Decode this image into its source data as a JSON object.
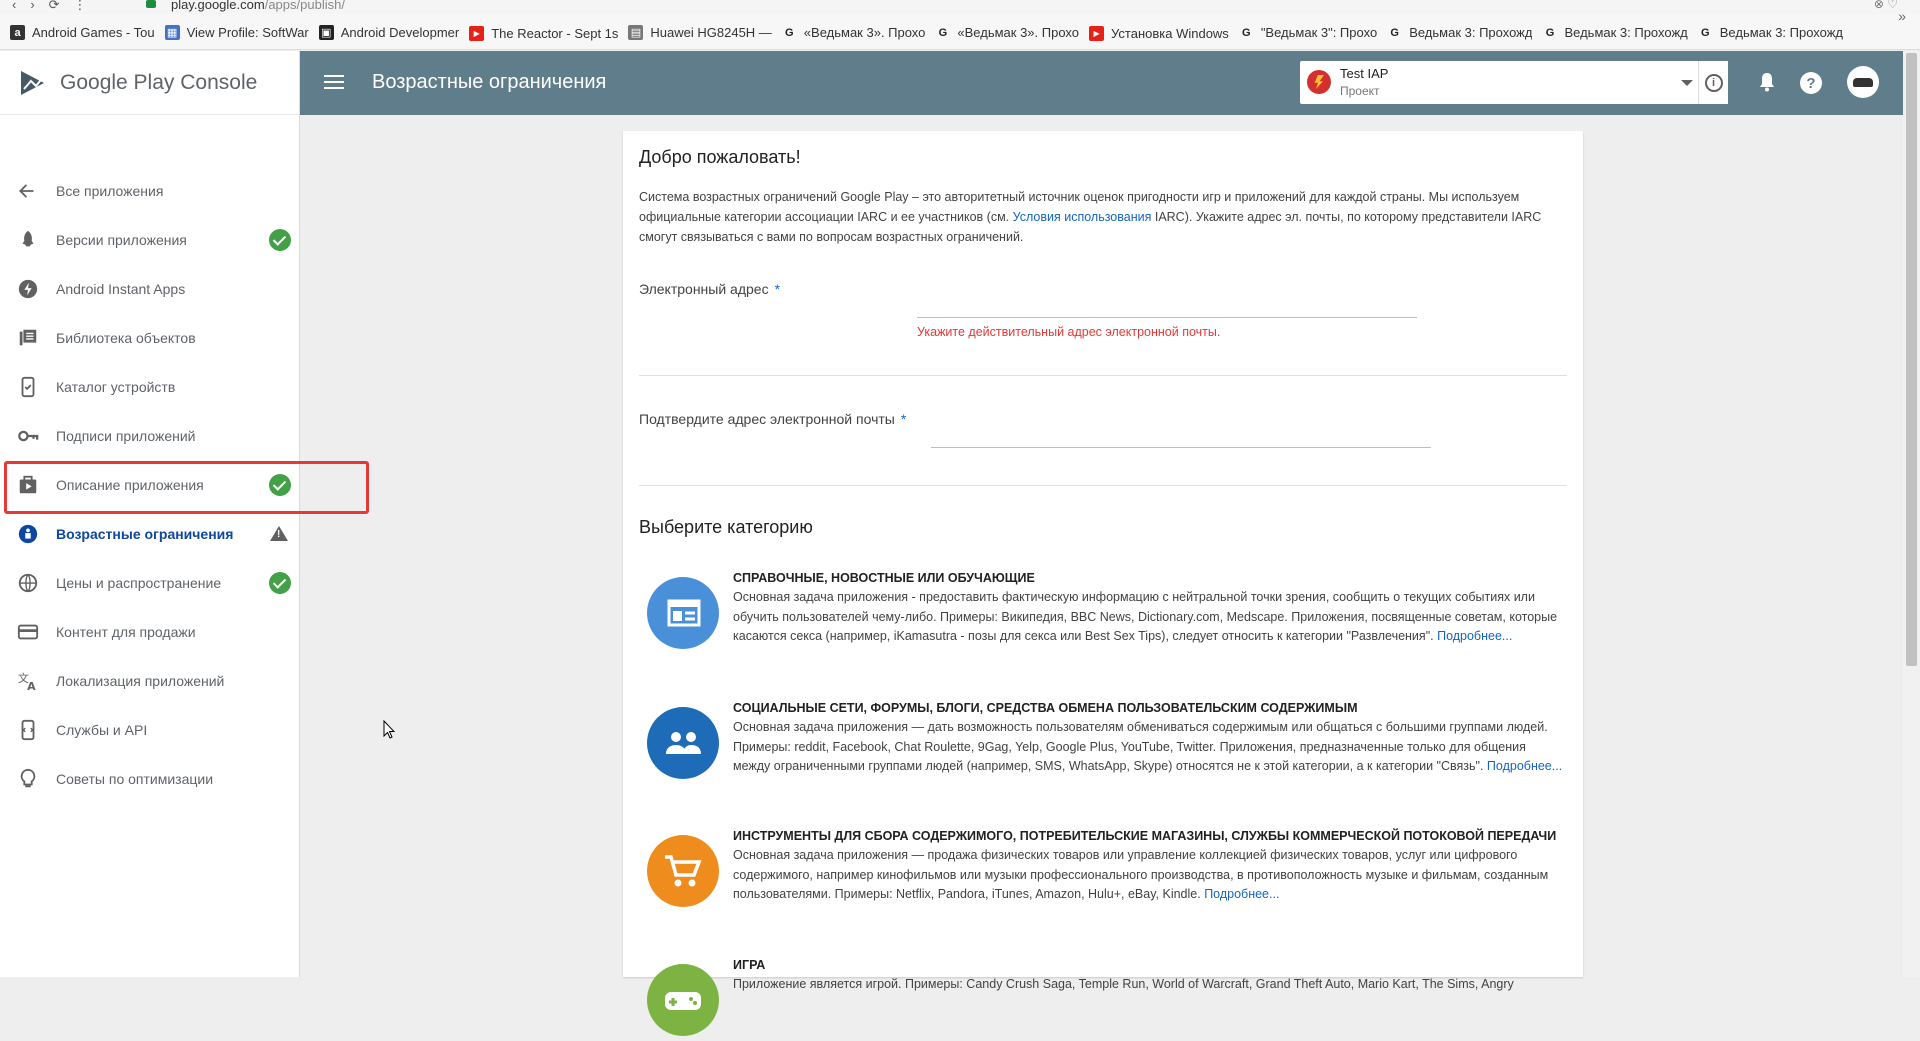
{
  "browser": {
    "url_host": "play.google.com",
    "url_path": "/apps/publish/",
    "bookmarks": [
      {
        "label": "Android Games - Tou",
        "icon": "android-games-icon",
        "color": "#333333",
        "glyph": "a"
      },
      {
        "label": "View Profile: SoftWar",
        "icon": "profile-icon",
        "color": "#4472c4",
        "glyph": "▦"
      },
      {
        "label": "Android Developmer",
        "icon": "dev-icon",
        "color": "#222222",
        "glyph": "▣"
      },
      {
        "label": "The Reactor - Sept 1s",
        "icon": "youtube-icon",
        "color": "#e62117",
        "glyph": "▶"
      },
      {
        "label": "Huawei HG8245H —",
        "icon": "document-icon",
        "color": "#777777",
        "glyph": "▤"
      },
      {
        "label": "«Ведьмак 3». Прохо",
        "icon": "g-icon",
        "color": "#ffffff",
        "glyph": "G"
      },
      {
        "label": "«Ведьмак 3». Прохо",
        "icon": "g-icon",
        "color": "#ffffff",
        "glyph": "G"
      },
      {
        "label": "Установка Windows",
        "icon": "youtube-icon",
        "color": "#e62117",
        "glyph": "▶"
      },
      {
        "label": "\"Ведьмак 3\": Прохо",
        "icon": "g-icon",
        "color": "#ffffff",
        "glyph": "G"
      },
      {
        "label": "Ведьмак 3: Прохожд",
        "icon": "g-icon",
        "color": "#ffffff",
        "glyph": "G"
      },
      {
        "label": "Ведьмак 3: Прохожд",
        "icon": "g-icon",
        "color": "#ffffff",
        "glyph": "G"
      },
      {
        "label": "Ведьмак 3: Прохожд",
        "icon": "g-icon",
        "color": "#ffffff",
        "glyph": "G"
      }
    ],
    "more": "»"
  },
  "sidebar": {
    "logo_text": "Google Play Console",
    "items": [
      {
        "label": "Все приложения",
        "icon": "arrow-back-icon",
        "status": "none"
      },
      {
        "label": "Версии приложения",
        "icon": "rocket-icon",
        "status": "check"
      },
      {
        "label": "Android Instant Apps",
        "icon": "bolt-icon",
        "status": "none"
      },
      {
        "label": "Библиотека объектов",
        "icon": "library-icon",
        "status": "none"
      },
      {
        "label": "Каталог устройств",
        "icon": "device-catalog-icon",
        "status": "none"
      },
      {
        "label": "Подписи приложений",
        "icon": "key-icon",
        "status": "none"
      },
      {
        "label": "Описание приложения",
        "icon": "shop-icon",
        "status": "check"
      },
      {
        "label": "Возрастные ограничения",
        "icon": "content-rating-icon",
        "status": "warning",
        "active": true
      },
      {
        "label": "Цены и распространение",
        "icon": "globe-icon",
        "status": "check"
      },
      {
        "label": "Контент для продажи",
        "icon": "credit-card-icon",
        "status": "none"
      },
      {
        "label": "Локализация приложений",
        "icon": "translate-icon",
        "status": "none"
      },
      {
        "label": "Службы и API",
        "icon": "api-icon",
        "status": "none"
      },
      {
        "label": "Советы по оптимизации",
        "icon": "lightbulb-icon",
        "status": "none"
      }
    ]
  },
  "header": {
    "title": "Возрастные ограничения",
    "project_name": "Test IAP",
    "project_sub": "Проект",
    "info_glyph": "i",
    "help_glyph": "?"
  },
  "main": {
    "welcome": "Добро пожаловать!",
    "intro_part1": "Система возрастных ограничений Google Play – это авторитетный источник оценок пригодности игр и приложений для каждой страны. Мы используем официальные категории ассоциации IARC и ее участников (см. ",
    "intro_link": "Условия использования",
    "intro_part2": " IARC). Укажите адрес эл. почты, по которому представители IARC смогут связываться с вами по вопросам возрастных ограничений.",
    "email_label": "Электронный адрес",
    "email_value": "",
    "email_error": "Укажите действительный адрес электронной почты.",
    "confirm_label": "Подтвердите адрес электронной почты",
    "confirm_value": "",
    "required_mark": "*",
    "category_title": "Выберите категорию",
    "more_link": "Подробнее...",
    "categories": [
      {
        "title": "СПРАВОЧНЫЕ, НОВОСТНЫЕ ИЛИ ОБУЧАЮЩИЕ",
        "desc": "Основная задача приложения - предоставить фактическую информацию с нейтральной точки зрения, сообщить о текущих событиях или обучить пользователей чему-либо. Примеры: Википедия, BBC News, Dictionary.com, Medscape. Приложения, посвященные советам, которые касаются секса (например, iKamasutra - позы для секса или Best Sex Tips), следует относить к категории \"Развлечения\". ",
        "color": "#4a90d9",
        "icon": "reference-news-icon"
      },
      {
        "title": "СОЦИАЛЬНЫЕ СЕТИ, ФОРУМЫ, БЛОГИ, СРЕДСТВА ОБМЕНА ПОЛЬЗОВАТЕЛЬСКИМ СОДЕРЖИМЫМ",
        "desc": "Основная задача приложения — дать возможность пользователям обмениваться содержимым или общаться с большими группами людей. Примеры: reddit, Facebook, Chat Roulette, 9Gag, Yelp, Google Plus, YouTube, Twitter. Приложения, предназначенные только для общения между ограниченными группами людей (например, SMS, WhatsApp, Skype) относятся не к этой категории, а к категории \"Связь\". ",
        "color": "#1e6bb8",
        "icon": "people-icon"
      },
      {
        "title": "ИНСТРУМЕНТЫ ДЛЯ СБОРА СОДЕРЖИМОГО, ПОТРЕБИТЕЛЬСКИЕ МАГАЗИНЫ, СЛУЖБЫ КОММЕРЧЕСКОЙ ПОТОКОВОЙ ПЕРЕДАЧИ",
        "desc": "Основная задача приложения — продажа физических товаров или управление коллекцией физических товаров, услуг или цифрового содержимого, например кинофильмов или музыки профессионального производства, в противоположность музыке и фильмам, созданным пользователями. Примеры: Netflix, Pandora, iTunes, Amazon, Hulu+, eBay, Kindle. ",
        "color": "#ef8c1e",
        "icon": "shopping-cart-icon"
      },
      {
        "title": "ИГРА",
        "desc": "Приложение является игрой. Примеры: Candy Crush Saga, Temple Run, World of Warcraft, Grand Theft Auto, Mario Kart, The Sims, Angry",
        "color": "#7cb342",
        "icon": "gamepad-icon"
      }
    ]
  },
  "colors": {
    "appbar": "#607d8b",
    "active": "#0d47a1",
    "check": "#43a047",
    "error": "#e53935",
    "highlight": "#e53935"
  }
}
